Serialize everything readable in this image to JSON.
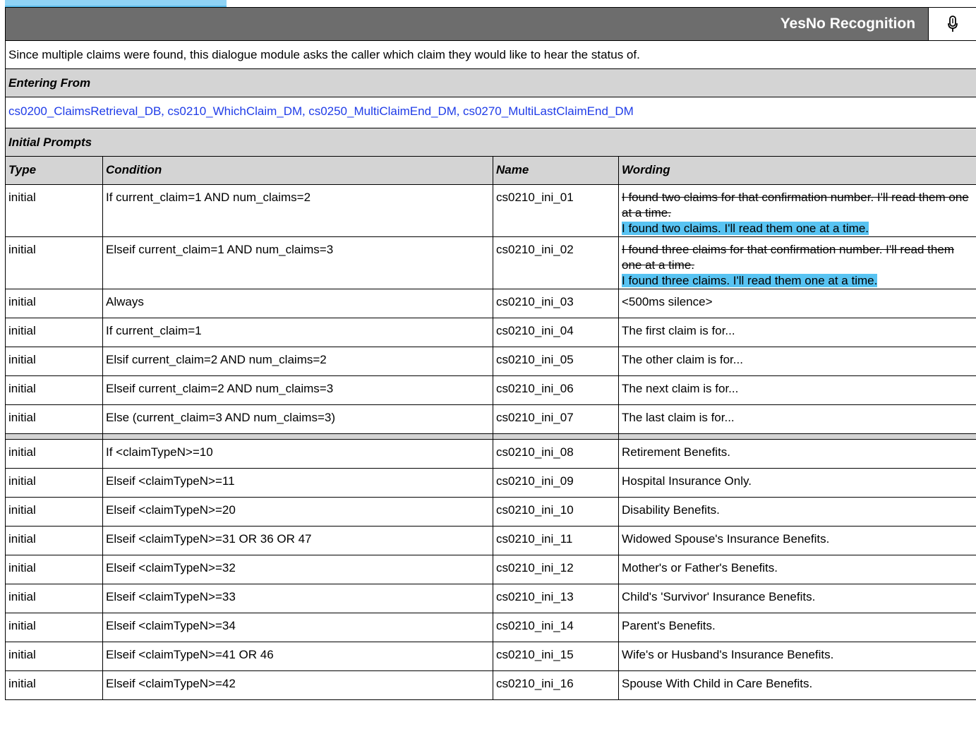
{
  "header": {
    "title": "YesNo Recognition",
    "icon": "microphone-icon"
  },
  "description": "Since multiple claims were found, this dialogue module asks the caller which claim they would like to hear the status of.",
  "entering_from": {
    "label": "Entering From",
    "links": [
      "cs0200_ClaimsRetrieval_DB",
      "cs0210_WhichClaim_DM",
      "cs0250_MultiClaimEnd_DM",
      "cs0270_MultiLastClaimEnd_DM"
    ],
    "separator": ","
  },
  "initial_prompts": {
    "label": "Initial Prompts",
    "columns": {
      "type": "Type",
      "condition": "Condition",
      "name": "Name",
      "wording": "Wording"
    },
    "rows": [
      {
        "type": "initial",
        "condition": "If current_claim=1 AND num_claims=2",
        "name": "cs0210_ini_01",
        "wording_struck": "I found two claims for that confirmation number. I'll read them one at a time.",
        "wording": "I found two claims. I'll read them one at a time."
      },
      {
        "type": "initial",
        "condition": "Elseif current_claim=1 AND num_claims=3",
        "name": "cs0210_ini_02",
        "wording_struck": "I found three claims for that confirmation number. I'll read them one at a time.",
        "wording": "I found three claims. I'll read them one at a time."
      },
      {
        "type": "initial",
        "condition": "Always",
        "name": "cs0210_ini_03",
        "wording": "<500ms silence>"
      },
      {
        "type": "initial",
        "condition": "If current_claim=1",
        "name": "cs0210_ini_04",
        "wording": "The first claim is for..."
      },
      {
        "type": "initial",
        "condition": "Elsif current_claim=2 AND num_claims=2",
        "name": "cs0210_ini_05",
        "wording": "The other claim is for..."
      },
      {
        "type": "initial",
        "condition": "Elseif current_claim=2 AND num_claims=3",
        "name": "cs0210_ini_06",
        "wording": "The next claim is for..."
      },
      {
        "type": "initial",
        "condition": "Else (current_claim=3 AND num_claims=3)",
        "name": "cs0210_ini_07",
        "wording": "The last claim is for..."
      },
      {
        "type": "initial",
        "condition": "If <claimTypeN>=10",
        "name": "cs0210_ini_08",
        "wording": "Retirement Benefits."
      },
      {
        "type": "initial",
        "condition": "Elseif <claimTypeN>=11",
        "name": "cs0210_ini_09",
        "wording": "Hospital Insurance Only."
      },
      {
        "type": "initial",
        "condition": "Elseif <claimTypeN>=20",
        "name": "cs0210_ini_10",
        "wording": "Disability Benefits."
      },
      {
        "type": "initial",
        "condition": "Elseif <claimTypeN>=31 OR 36 OR 47",
        "name": "cs0210_ini_11",
        "wording": "Widowed Spouse's Insurance Benefits."
      },
      {
        "type": "initial",
        "condition": "Elseif <claimTypeN>=32",
        "name": "cs0210_ini_12",
        "wording": "Mother's or Father's Benefits."
      },
      {
        "type": "initial",
        "condition": "Elseif <claimTypeN>=33",
        "name": "cs0210_ini_13",
        "wording": "Child's 'Survivor' Insurance Benefits."
      },
      {
        "type": "initial",
        "condition": "Elseif <claimTypeN>=34",
        "name": "cs0210_ini_14",
        "wording": "Parent's Benefits."
      },
      {
        "type": "initial",
        "condition": "Elseif <claimTypeN>=41 OR 46",
        "name": "cs0210_ini_15",
        "wording": "Wife's or Husband's Insurance Benefits."
      },
      {
        "type": "initial",
        "condition": "Elseif <claimTypeN>=42",
        "name": "cs0210_ini_16",
        "wording": "Spouse With Child in Care Benefits."
      }
    ]
  }
}
